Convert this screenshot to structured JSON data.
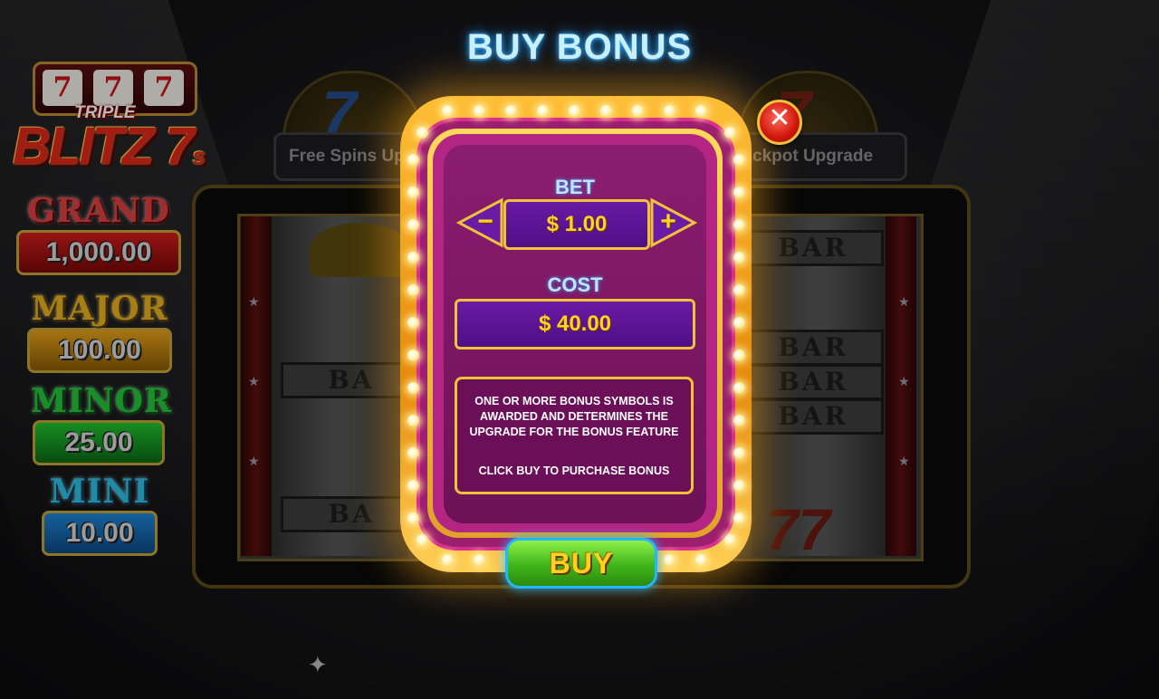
{
  "game": {
    "logo": {
      "reel_symbols": [
        "7",
        "7",
        "7"
      ],
      "line1": "TRIPLE",
      "line2": "BLITZ 7",
      "line2_suffix": "s"
    },
    "jackpots": [
      {
        "name": "GRAND",
        "value": "1,000.00",
        "color": "#e04040"
      },
      {
        "name": "MAJOR",
        "value": "100.00",
        "color": "#e6b21e"
      },
      {
        "name": "MINOR",
        "value": "25.00",
        "color": "#22c73a"
      },
      {
        "name": "MINI",
        "value": "10.00",
        "color": "#2ec0e6"
      }
    ],
    "features": {
      "left_label": "Free Spins Up",
      "right_label": "ckpot Upgrade"
    },
    "reel_symbols": {
      "bar": "BAR",
      "partial_bar": "BA"
    }
  },
  "dialog": {
    "title": "BUY BONUS",
    "bet_label": "BET",
    "bet_value": "$ 1.00",
    "decrease_icon": "−",
    "increase_icon": "+",
    "cost_label": "COST",
    "cost_value": "$ 40.00",
    "info_text_1": "ONE OR MORE BONUS SYMBOLS IS AWARDED AND DETERMINES THE UPGRADE FOR THE BONUS FEATURE",
    "info_text_2": "CLICK BUY TO PURCHASE BONUS",
    "buy_label": "BUY",
    "close_icon": "✕",
    "accent_color": "#ffd21f",
    "panel_color": "#9b1f6e"
  }
}
